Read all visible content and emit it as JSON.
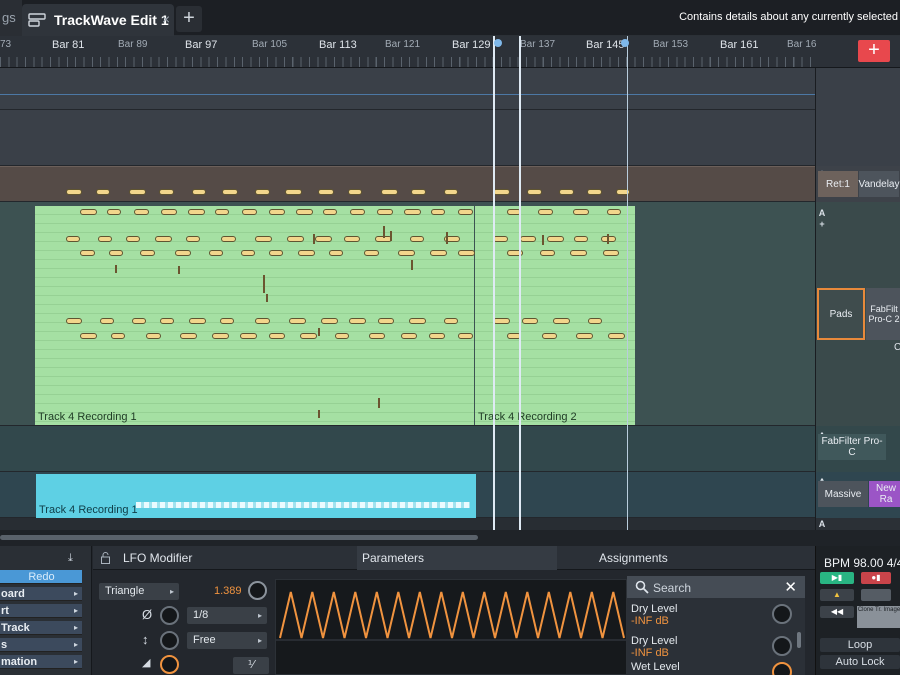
{
  "tabs": {
    "previous_tab_label": "gs",
    "active_tab_label": "TrackWave Edit 1",
    "close_glyph": "×",
    "add_glyph": "+"
  },
  "header": {
    "info_text": "Contains details about any currently selected"
  },
  "ruler": {
    "bar_labels": [
      "73",
      "Bar 81",
      "Bar 89",
      "Bar 97",
      "Bar 105",
      "Bar 113",
      "Bar 121",
      "Bar 129",
      "Bar 137",
      "Bar 145",
      "Bar 153",
      "Bar 161",
      "Bar 16"
    ],
    "add_glyph": "+"
  },
  "clips": {
    "green_1_label": "Track 4 Recording 1",
    "green_2_label": "Track 4 Recording 2",
    "blue_label": "Track 4 Recording 1"
  },
  "rack": {
    "ret_label": "Ret:1",
    "vandelay_label": "Vandelay",
    "pads_label": "Pads",
    "fabfilter_label": "FabFilt Pro-C 2",
    "clipped_label": "C",
    "fabfilter_proc_label": "FabFilter Pro-C",
    "massive_label": "Massive",
    "newra_label": "New Ra",
    "auto_glyph": "A",
    "plus_glyph": "+"
  },
  "left_panel": {
    "redo_label": "Redo",
    "items": [
      "oard",
      "rt",
      "Track",
      "s",
      "mation"
    ]
  },
  "lfo": {
    "title": "LFO Modifier",
    "parameters_tab": "Parameters",
    "assignments_tab": "Assignments",
    "shape": "Triangle",
    "rate_value": "1.389",
    "division": "1/8",
    "sync_mode": "Free",
    "phase_symbol": "Ø",
    "updown_symbol": "↕",
    "ramp_symbol": "◢",
    "fraction_button": "⅟"
  },
  "assignments": {
    "search_placeholder": "Search",
    "close_glyph": "✕",
    "items": [
      {
        "name": "Dry Level",
        "value": "-INF dB"
      },
      {
        "name": "Dry Level",
        "value": "-INF dB"
      },
      {
        "name": "Wet Level",
        "value": ""
      }
    ]
  },
  "transport": {
    "bpm_text": "BPM  98.00  4/4",
    "loop_label": "Loop",
    "autolock_label": "Auto Lock",
    "clip_text": "Clone Tr. Image"
  },
  "colors": {
    "clip_green": "#a5e0a3",
    "clip_blue": "#5ed0e4",
    "accent_orange": "#f0933f",
    "lfo_wave": "#f0933f",
    "add_red": "#e8484d"
  }
}
